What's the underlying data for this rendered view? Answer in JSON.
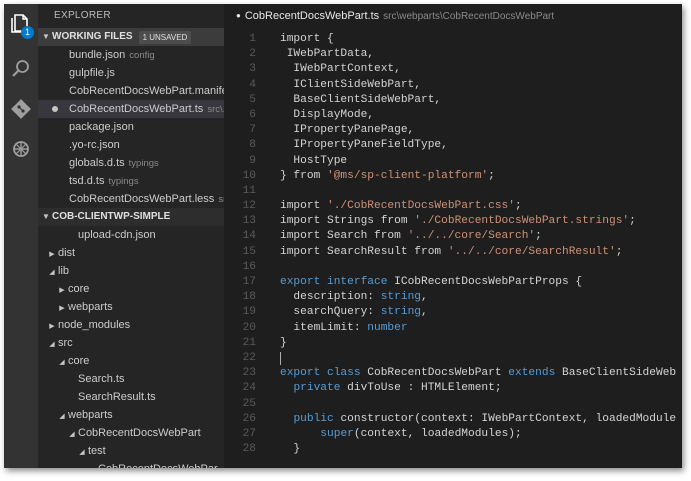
{
  "activity_bar": {
    "explorer_badge": "1",
    "icons": [
      "files-icon",
      "search-icon",
      "git-icon",
      "debug-icon"
    ]
  },
  "sidebar": {
    "title": "EXPLORER",
    "working_files": {
      "header": "WORKING FILES",
      "badge": "1 UNSAVED",
      "items": [
        {
          "name": "bundle.json",
          "desc": "config",
          "unsaved": false,
          "selected": false
        },
        {
          "name": "gulpfile.js",
          "desc": "",
          "unsaved": false,
          "selected": false
        },
        {
          "name": "CobRecentDocsWebPart.manife...",
          "desc": "",
          "unsaved": false,
          "selected": false
        },
        {
          "name": "CobRecentDocsWebPart.ts",
          "desc": "src\\...",
          "unsaved": true,
          "selected": true
        },
        {
          "name": "package.json",
          "desc": "",
          "unsaved": false,
          "selected": false
        },
        {
          "name": ".yo-rc.json",
          "desc": "",
          "unsaved": false,
          "selected": false
        },
        {
          "name": "globals.d.ts",
          "desc": "typings",
          "unsaved": false,
          "selected": false
        },
        {
          "name": "tsd.d.ts",
          "desc": "typings",
          "unsaved": false,
          "selected": false
        },
        {
          "name": "CobRecentDocsWebPart.less",
          "desc": "src...",
          "unsaved": false,
          "selected": false
        }
      ]
    },
    "project": {
      "header": "COB-CLIENTWP-SIMPLE",
      "items": [
        {
          "name": "upload-cdn.json",
          "twisty": "",
          "depth": 3
        },
        {
          "name": "dist",
          "twisty": "right",
          "depth": 1
        },
        {
          "name": "lib",
          "twisty": "down",
          "depth": 1
        },
        {
          "name": "core",
          "twisty": "right",
          "depth": 2
        },
        {
          "name": "webparts",
          "twisty": "right",
          "depth": 2
        },
        {
          "name": "node_modules",
          "twisty": "right",
          "depth": 1
        },
        {
          "name": "src",
          "twisty": "down",
          "depth": 1
        },
        {
          "name": "core",
          "twisty": "down",
          "depth": 2
        },
        {
          "name": "Search.ts",
          "twisty": "",
          "depth": 3
        },
        {
          "name": "SearchResult.ts",
          "twisty": "",
          "depth": 3
        },
        {
          "name": "webparts",
          "twisty": "down",
          "depth": 2
        },
        {
          "name": "CobRecentDocsWebPart",
          "twisty": "down",
          "depth": 3
        },
        {
          "name": "test",
          "twisty": "down",
          "depth": 4
        },
        {
          "name": "CobRecentDocsWebPar...",
          "twisty": "",
          "depth": 5
        }
      ]
    }
  },
  "editor": {
    "tab_title": "CobRecentDocsWebPart.ts",
    "tab_path": "src\\webparts\\CobRecentDocsWebPart",
    "lines": [
      {
        "n": "1",
        "segs": [
          {
            "t": "import {",
            "c": "k0"
          }
        ]
      },
      {
        "n": "2",
        "segs": [
          {
            "t": " IWebPartData,",
            "c": ""
          }
        ]
      },
      {
        "n": "3",
        "segs": [
          {
            "t": "  IWebPartContext,",
            "c": ""
          }
        ]
      },
      {
        "n": "4",
        "segs": [
          {
            "t": "  IClientSideWebPart,",
            "c": ""
          }
        ]
      },
      {
        "n": "5",
        "segs": [
          {
            "t": "  BaseClientSideWebPart,",
            "c": ""
          }
        ]
      },
      {
        "n": "6",
        "segs": [
          {
            "t": "  DisplayMode,",
            "c": ""
          }
        ]
      },
      {
        "n": "7",
        "segs": [
          {
            "t": "  IPropertyPanePage,",
            "c": ""
          }
        ]
      },
      {
        "n": "8",
        "segs": [
          {
            "t": "  IPropertyPaneFieldType,",
            "c": ""
          }
        ]
      },
      {
        "n": "9",
        "segs": [
          {
            "t": "  HostType",
            "c": ""
          }
        ]
      },
      {
        "n": "10",
        "segs": [
          {
            "t": "} from ",
            "c": ""
          },
          {
            "t": "'@ms/sp-client-platform'",
            "c": "s"
          },
          {
            "t": ";",
            "c": ""
          }
        ]
      },
      {
        "n": "11",
        "segs": []
      },
      {
        "n": "12",
        "segs": [
          {
            "t": "import ",
            "c": ""
          },
          {
            "t": "'./CobRecentDocsWebPart.css'",
            "c": "s"
          },
          {
            "t": ";",
            "c": ""
          }
        ]
      },
      {
        "n": "13",
        "segs": [
          {
            "t": "import Strings from ",
            "c": ""
          },
          {
            "t": "'./CobRecentDocsWebPart.strings'",
            "c": "s"
          },
          {
            "t": ";",
            "c": ""
          }
        ]
      },
      {
        "n": "14",
        "segs": [
          {
            "t": "import Search from ",
            "c": ""
          },
          {
            "t": "'../../core/Search'",
            "c": "s"
          },
          {
            "t": ";",
            "c": ""
          }
        ]
      },
      {
        "n": "15",
        "segs": [
          {
            "t": "import SearchResult from ",
            "c": ""
          },
          {
            "t": "'../../core/SearchResult'",
            "c": "s"
          },
          {
            "t": ";",
            "c": ""
          }
        ]
      },
      {
        "n": "16",
        "segs": []
      },
      {
        "n": "17",
        "segs": [
          {
            "t": "export interface",
            "c": "k"
          },
          {
            "t": " ICobRecentDocsWebPartProps {",
            "c": ""
          }
        ]
      },
      {
        "n": "18",
        "segs": [
          {
            "t": "  description: ",
            "c": ""
          },
          {
            "t": "string",
            "c": "k"
          },
          {
            "t": ",",
            "c": ""
          }
        ]
      },
      {
        "n": "19",
        "segs": [
          {
            "t": "  searchQuery: ",
            "c": ""
          },
          {
            "t": "string",
            "c": "k"
          },
          {
            "t": ",",
            "c": ""
          }
        ]
      },
      {
        "n": "20",
        "segs": [
          {
            "t": "  itemLimit: ",
            "c": ""
          },
          {
            "t": "number",
            "c": "k"
          }
        ]
      },
      {
        "n": "21",
        "segs": [
          {
            "t": "}",
            "c": ""
          }
        ]
      },
      {
        "n": "22",
        "segs": [],
        "cursor": true
      },
      {
        "n": "23",
        "segs": [
          {
            "t": "export class",
            "c": "k"
          },
          {
            "t": " CobRecentDocsWebPart ",
            "c": ""
          },
          {
            "t": "extends",
            "c": "k"
          },
          {
            "t": " BaseClientSideWebPart<I",
            "c": ""
          }
        ]
      },
      {
        "n": "24",
        "segs": [
          {
            "t": "  ",
            "c": ""
          },
          {
            "t": "private",
            "c": "k"
          },
          {
            "t": " divToUse : HTMLElement;",
            "c": ""
          }
        ]
      },
      {
        "n": "25",
        "segs": []
      },
      {
        "n": "26",
        "segs": [
          {
            "t": "  ",
            "c": ""
          },
          {
            "t": "public",
            "c": "k"
          },
          {
            "t": " constructor(context: IWebPartContext, loadedModules: { [",
            "c": ""
          }
        ]
      },
      {
        "n": "27",
        "segs": [
          {
            "t": "      ",
            "c": ""
          },
          {
            "t": "super",
            "c": "k"
          },
          {
            "t": "(context, loadedModules);",
            "c": ""
          }
        ]
      },
      {
        "n": "28",
        "segs": [
          {
            "t": "  }",
            "c": ""
          }
        ]
      }
    ]
  },
  "colors": {
    "keyword": "#569cd6",
    "string": "#ce9178",
    "text": "#d4d4d4",
    "line_number": "#5a5a5a",
    "badge": "#007acc"
  }
}
